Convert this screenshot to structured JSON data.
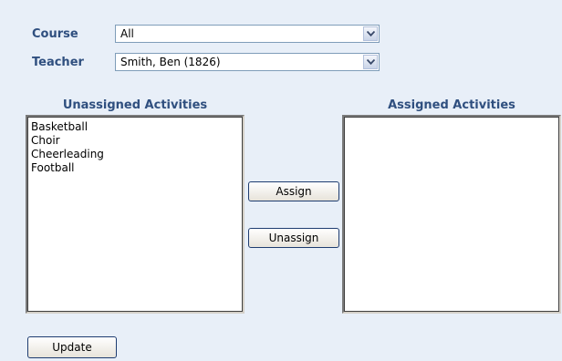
{
  "filters": {
    "course_label": "Course",
    "course_value": "All",
    "teacher_label": "Teacher",
    "teacher_value": "Smith, Ben (1826)"
  },
  "unassigned": {
    "heading": "Unassigned Activities",
    "items": [
      "Basketball",
      "Choir",
      "Cheerleading",
      "Football"
    ]
  },
  "assigned": {
    "heading": "Assigned Activities",
    "items": []
  },
  "actions": {
    "assign_label": "Assign",
    "unassign_label": "Unassign",
    "update_label": "Update"
  },
  "icons": {
    "dropdown": "chevron-down-icon"
  },
  "colors": {
    "label": "#2f4f7f",
    "panel_bg": "#e8eff8",
    "button_border": "#1e3c70"
  }
}
